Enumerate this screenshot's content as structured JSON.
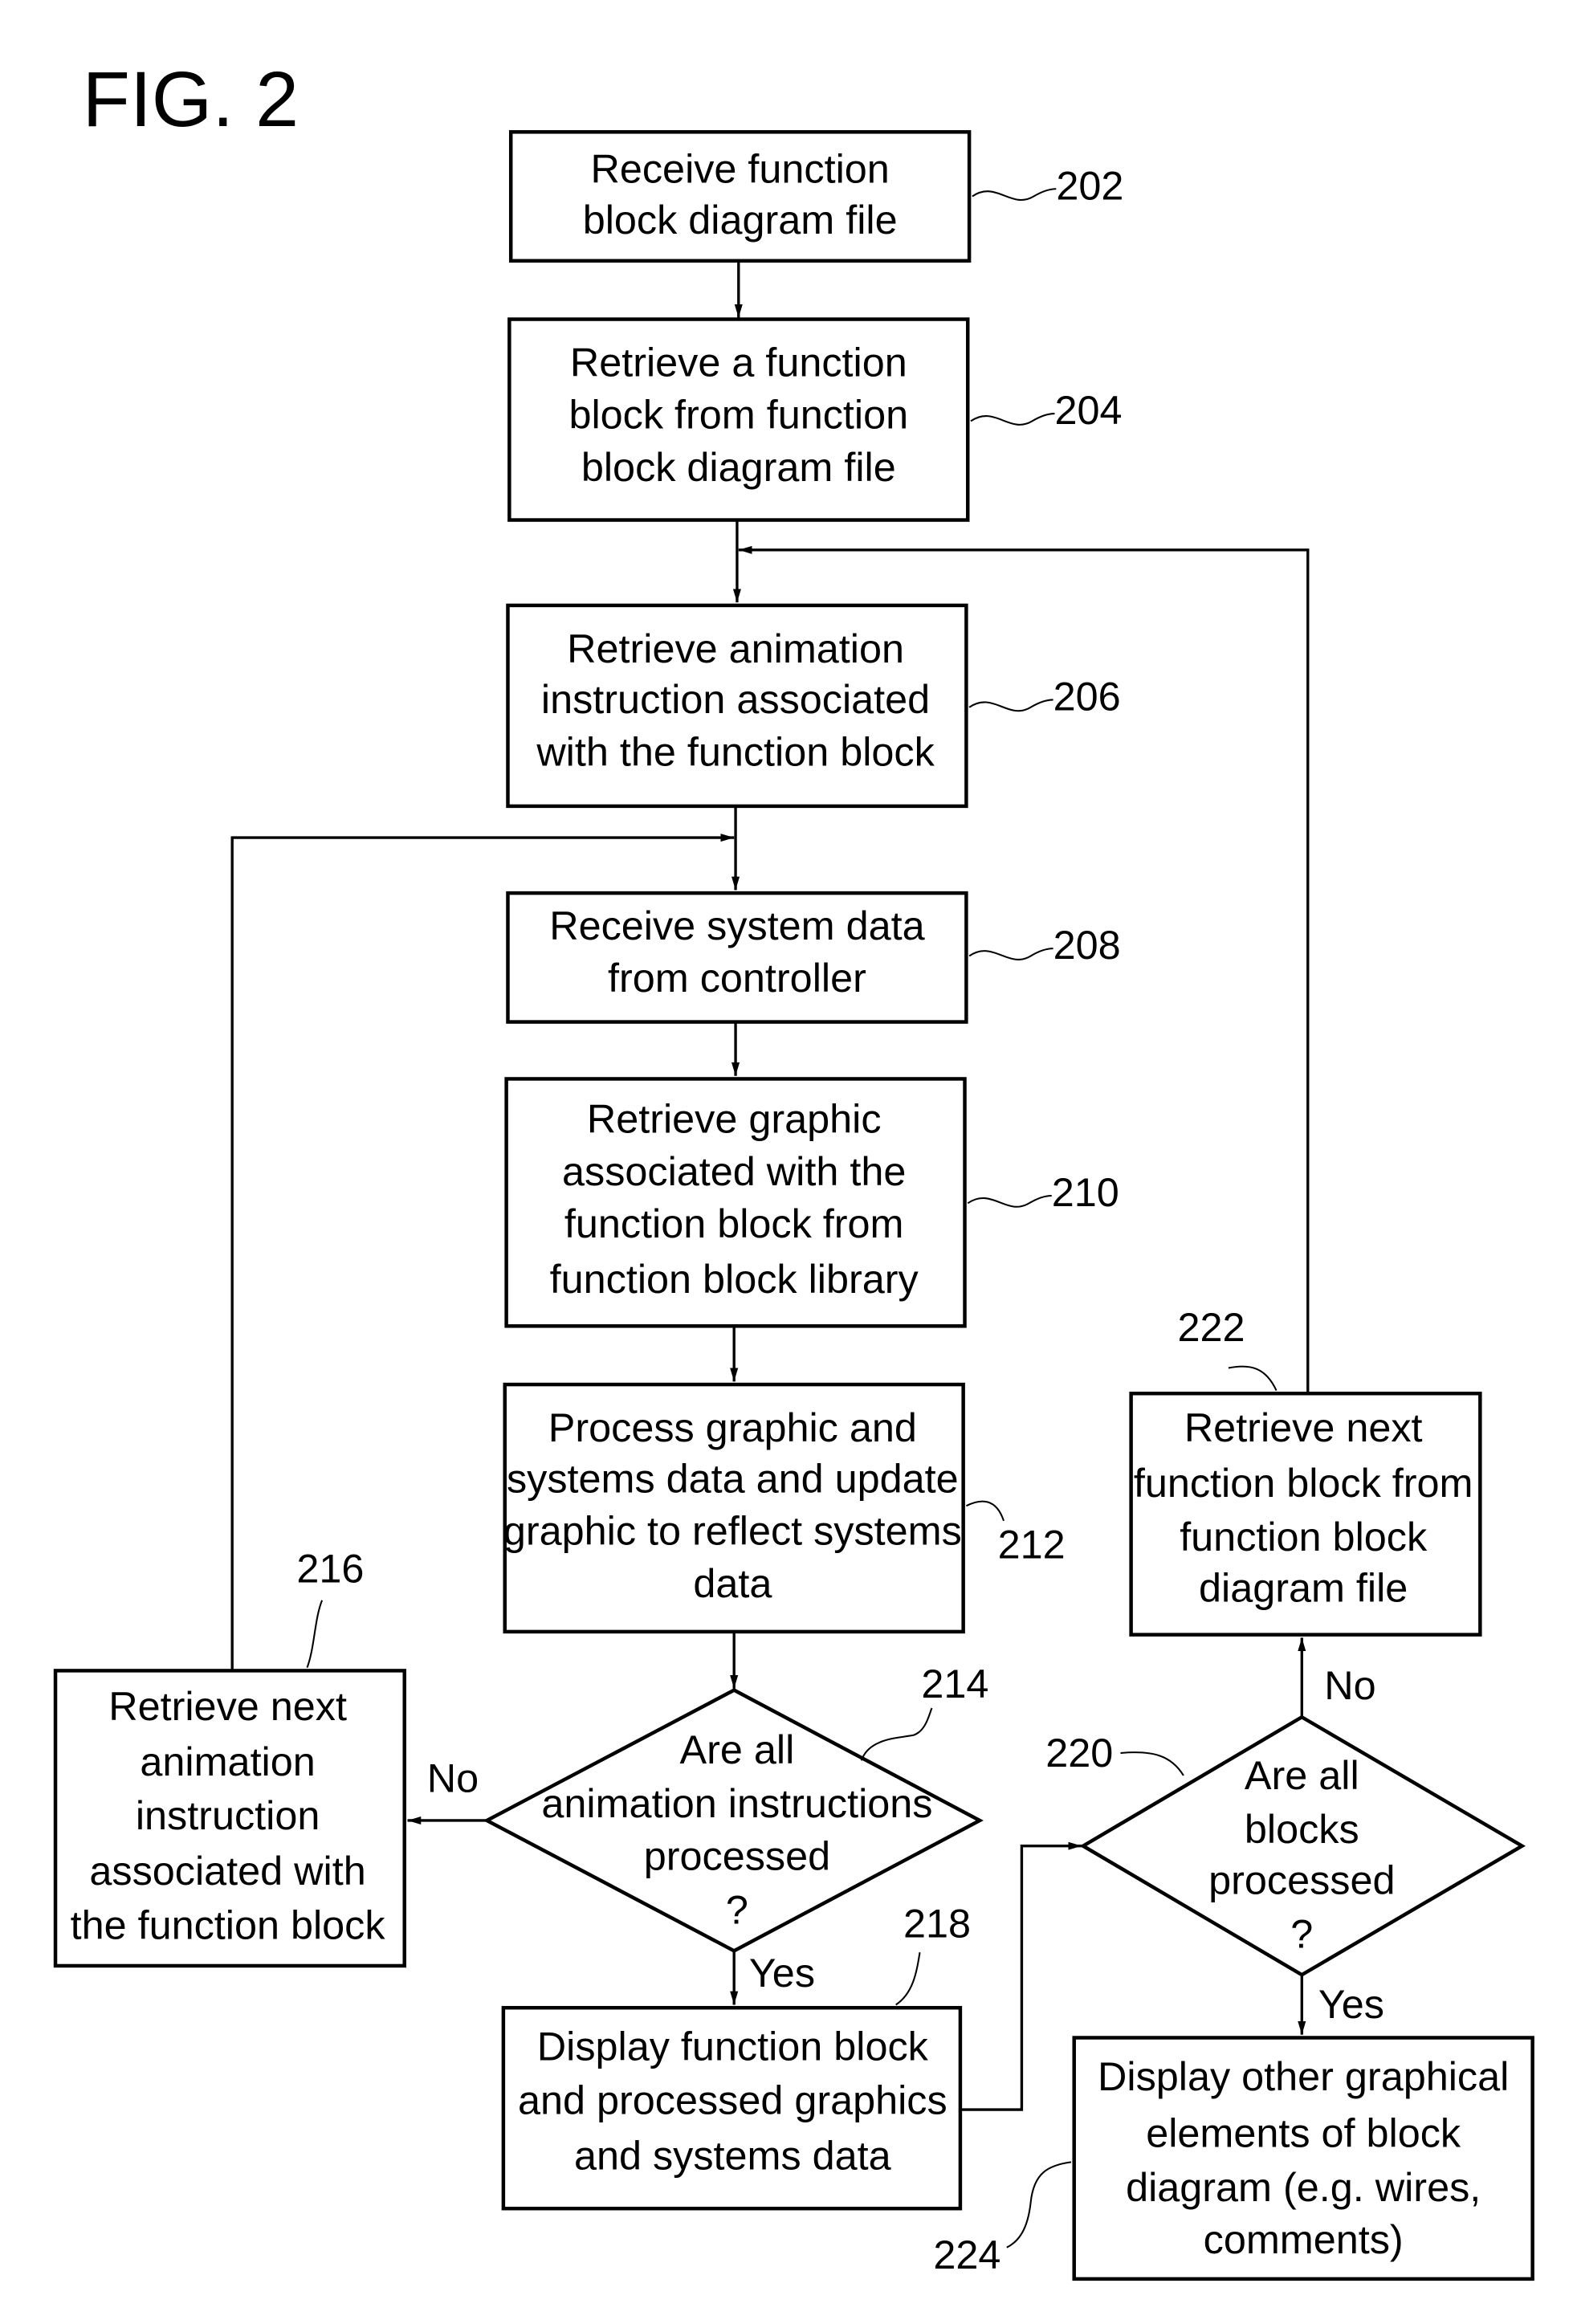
{
  "figure_title": "FIG. 2",
  "nodes": {
    "n202": {
      "ref": "202",
      "lines": [
        "Receive function",
        "block diagram file"
      ]
    },
    "n204": {
      "ref": "204",
      "lines": [
        "Retrieve a function",
        "block from function",
        "block diagram file"
      ]
    },
    "n206": {
      "ref": "206",
      "lines": [
        "Retrieve animation",
        "instruction associated",
        "with the function block"
      ]
    },
    "n208": {
      "ref": "208",
      "lines": [
        "Receive system data",
        "from controller"
      ]
    },
    "n210": {
      "ref": "210",
      "lines": [
        "Retrieve graphic",
        "associated with the",
        "function block from",
        "function block library"
      ]
    },
    "n212": {
      "ref": "212",
      "lines": [
        "Process graphic and",
        "systems data and update",
        "graphic to reflect systems",
        "data"
      ]
    },
    "n214": {
      "ref": "214",
      "lines": [
        "Are all",
        "animation instructions",
        "processed",
        "?"
      ]
    },
    "n216": {
      "ref": "216",
      "lines": [
        "Retrieve next",
        "animation",
        "instruction",
        "associated with",
        "the function block"
      ]
    },
    "n218": {
      "ref": "218",
      "lines": [
        "Display function block",
        "and processed graphics",
        "and systems data"
      ]
    },
    "n220": {
      "ref": "220",
      "lines": [
        "Are all",
        "blocks",
        "processed",
        "?"
      ]
    },
    "n222": {
      "ref": "222",
      "lines": [
        "Retrieve next",
        "function block from",
        "function block",
        "diagram file"
      ]
    },
    "n224": {
      "ref": "224",
      "lines": [
        "Display other graphical",
        "elements of block",
        "diagram (e.g. wires,",
        "comments)"
      ]
    }
  },
  "edge_labels": {
    "d214_no": "No",
    "d214_yes": "Yes",
    "d220_no": "No",
    "d220_yes": "Yes"
  }
}
